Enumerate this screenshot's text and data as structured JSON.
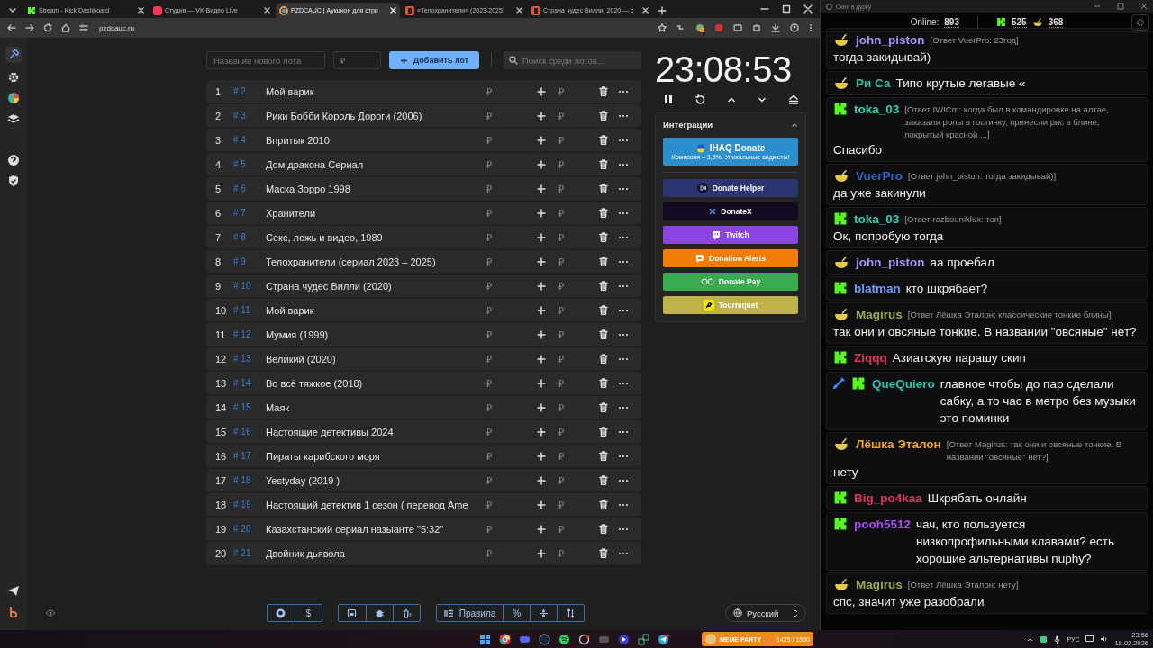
{
  "browser": {
    "tabs": [
      {
        "title": "Stream - Kick Dashboard",
        "kind": "kick",
        "selected": false
      },
      {
        "title": "Студия — VK Видео Live",
        "kind": "vk",
        "selected": false
      },
      {
        "title": "PZDCAUC | Аукцион для стри",
        "kind": "auc",
        "selected": true
      },
      {
        "title": "«Телохранители» (2023-2025)",
        "kind": "film",
        "selected": false
      },
      {
        "title": "Страна чудес Вилли, 2020 — с",
        "kind": "film",
        "selected": false
      }
    ],
    "address": "pzdcauc.ru"
  },
  "toolbar": {
    "name_placeholder": "Название нового лота",
    "price_placeholder": "₽",
    "add_button": "Добавить лот",
    "search_placeholder": "Поиск среди лотов..."
  },
  "lots": [
    {
      "index": "1",
      "id": "# 2",
      "name": "Мой варик",
      "amount": "₽",
      "add_placeholder": "₽"
    },
    {
      "index": "2",
      "id": "# 3",
      "name": "Рики Бобби Король Дороги (2006)",
      "amount": "₽",
      "add_placeholder": "₽"
    },
    {
      "index": "3",
      "id": "# 4",
      "name": "Впритык 2010",
      "amount": "₽",
      "add_placeholder": "₽"
    },
    {
      "index": "4",
      "id": "# 5",
      "name": "Дом дракона Сериал",
      "amount": "₽",
      "add_placeholder": "₽"
    },
    {
      "index": "5",
      "id": "# 6",
      "name": "Маска Зорро 1998",
      "amount": "₽",
      "add_placeholder": "₽"
    },
    {
      "index": "6",
      "id": "# 7",
      "name": "Хранители",
      "amount": "₽",
      "add_placeholder": "₽"
    },
    {
      "index": "7",
      "id": "# 8",
      "name": "Секс, ложь и видео, 1989",
      "amount": "₽",
      "add_placeholder": "₽"
    },
    {
      "index": "8",
      "id": "# 9",
      "name": "Телохранители (сериал 2023 – 2025)",
      "amount": "₽",
      "add_placeholder": "₽"
    },
    {
      "index": "9",
      "id": "# 10",
      "name": "Страна чудес Вилли (2020)",
      "amount": "₽",
      "add_placeholder": "₽"
    },
    {
      "index": "10",
      "id": "# 11",
      "name": "Мой варик",
      "amount": "₽",
      "add_placeholder": "₽"
    },
    {
      "index": "11",
      "id": "# 12",
      "name": "Мумия (1999)",
      "amount": "₽",
      "add_placeholder": "₽"
    },
    {
      "index": "12",
      "id": "# 13",
      "name": "Великий (2020)",
      "amount": "₽",
      "add_placeholder": "₽"
    },
    {
      "index": "13",
      "id": "# 14",
      "name": "Во всё тяжкое (2018)",
      "amount": "₽",
      "add_placeholder": "₽"
    },
    {
      "index": "14",
      "id": "# 15",
      "name": "Маяк",
      "amount": "₽",
      "add_placeholder": "₽"
    },
    {
      "index": "15",
      "id": "# 16",
      "name": "Настоящие детективы 2024",
      "amount": "₽",
      "add_placeholder": "₽"
    },
    {
      "index": "16",
      "id": "# 17",
      "name": "Пираты карибского моря",
      "amount": "₽",
      "add_placeholder": "₽"
    },
    {
      "index": "17",
      "id": "# 18",
      "name": "Yestyday (2019 )",
      "amount": "₽",
      "add_placeholder": "₽"
    },
    {
      "index": "18",
      "id": "# 19",
      "name": "Настоящий детектив 1 сезон ( перевод Ame",
      "amount": "₽",
      "add_placeholder": "₽"
    },
    {
      "index": "19",
      "id": "# 20",
      "name": "Казахстанский сериал назыанте \"5:32\"",
      "amount": "₽",
      "add_placeholder": "₽"
    },
    {
      "index": "20",
      "id": "# 21",
      "name": "Двойник дьявола",
      "amount": "₽",
      "add_placeholder": "₽"
    }
  ],
  "timer": {
    "time": "23:08:53"
  },
  "integrations": {
    "title": "Интеграции",
    "expanded": true,
    "services": [
      {
        "kind": "ihaq",
        "label": "IHAQ Donate",
        "note": "Комиссия – 3,5%. Уникальные виджеты!",
        "color": "#2b8fcf"
      },
      {
        "kind": "helper",
        "label": "Donate Helper",
        "color": "#2c3472"
      },
      {
        "kind": "donatex",
        "label": "DonateX",
        "color": "#120a1e"
      },
      {
        "kind": "twitch",
        "label": "Twitch",
        "color": "#8b44e0"
      },
      {
        "kind": "alerts",
        "label": "Donation Alerts",
        "color": "#f47c08"
      },
      {
        "kind": "pay",
        "label": "Donate Pay",
        "color": "#3bab4f"
      },
      {
        "kind": "tourniquet",
        "label": "Tourniquet",
        "color": "#bfb24a"
      }
    ]
  },
  "footer": {
    "dollar": "$",
    "rules": "Правила",
    "percent": "%",
    "language": "Русский"
  },
  "chat": {
    "window_title": "Окно в дурку",
    "online_label": "Online:",
    "online": "893",
    "kick_count": "525",
    "vk_count": "368",
    "messages": [
      {
        "kind": "vk",
        "moderator": false,
        "user": "john_piston",
        "color": "#a592f7",
        "reply": "[Ответ VuerPro: 23год]",
        "text": "тогда закидывай)"
      },
      {
        "kind": "vk",
        "moderator": false,
        "user": "Ри Са",
        "color": "#2bbf9e",
        "text": "Типо крутые легавые «"
      },
      {
        "kind": "kick",
        "moderator": false,
        "user": "toka_03",
        "color": "#2ecfb3",
        "reply": "[Ответ IWICm: когда был в командировке на алтае, заказали ролы в гостинку, принесли рис в блине, покрытый красной ...]",
        "text": "Спасибо"
      },
      {
        "kind": "vk",
        "moderator": false,
        "user": "VuerPro",
        "color": "#2c63c4",
        "reply": "[Ответ john_piston: тогда закидывай)]",
        "text": "да уже закинули"
      },
      {
        "kind": "kick",
        "moderator": false,
        "user": "toka_03",
        "color": "#2ecfb3",
        "reply": "[Ответ razbouniklux: топ]",
        "text": "Ок, попробую тогда"
      },
      {
        "kind": "vk",
        "moderator": false,
        "user": "john_piston",
        "color": "#a592f7",
        "text": "аа проебал"
      },
      {
        "kind": "kick",
        "moderator": false,
        "user": "blatman",
        "color": "#6a9bff",
        "text": "кто шкрябает?"
      },
      {
        "kind": "vk",
        "moderator": false,
        "user": "Magirus",
        "color": "#93ad4c",
        "reply": "[Ответ Лёшка Эталон: классические тонкие блины]",
        "text": "так они и овсяные тонкие. В названии \"овсяные\" нет?"
      },
      {
        "kind": "kick",
        "moderator": false,
        "user": "Ziqqq",
        "color": "#e2345c",
        "text": "Азиатскую парашу скип"
      },
      {
        "kind": "kick",
        "moderator": true,
        "user": "QueQuiero",
        "color": "#22c4b2",
        "text": "главное чтобы до пар сделали сабку, а то час в метро без музыки это поминки"
      },
      {
        "kind": "vk",
        "moderator": false,
        "user": "Лёшка Эталон",
        "color": "#f5a524",
        "reply": "[Ответ Magirus: так они и овсяные тонкие. В названии \"овсяные\" нет?]",
        "text": "нету"
      },
      {
        "kind": "kick",
        "moderator": false,
        "user": "Big_po4kaa",
        "color": "#e2345c",
        "text": "Шкрябать онлайн"
      },
      {
        "kind": "kick",
        "moderator": false,
        "user": "pooh5512",
        "color": "#a74cf5",
        "text": "чач, кто пользуется низкопрофильными клавами? есть хорошие альтернативы nuphy?"
      },
      {
        "kind": "vk",
        "moderator": false,
        "user": "Magirus",
        "color": "#93ad4c",
        "reply": "[Ответ Лёшка Эталон: нету]",
        "text": "спс, значит уже разобрали"
      }
    ]
  },
  "taskbar": {
    "widget_title": "MEME PARTY",
    "widget_count": "1425 / 1500",
    "language": "РУС",
    "time": "23:56",
    "date": "18.02.2026"
  }
}
